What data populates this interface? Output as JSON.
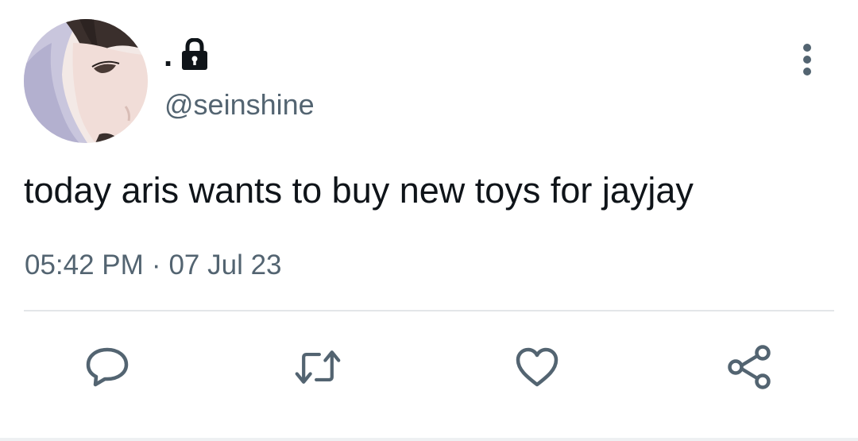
{
  "user": {
    "display_name": ".",
    "handle": "@seinshine",
    "protected_icon": "lock-icon",
    "avatar_icon": "avatar"
  },
  "tweet": {
    "text": "today aris wants to buy new toys for jayjay",
    "time": "05:42 PM",
    "separator": "·",
    "date": "07 Jul 23"
  },
  "actions": [
    {
      "name": "reply",
      "icon": "speech-bubble-icon"
    },
    {
      "name": "retweet",
      "icon": "retweet-icon"
    },
    {
      "name": "like",
      "icon": "heart-icon"
    },
    {
      "name": "share",
      "icon": "share-icon"
    }
  ],
  "menu": {
    "icon": "vertical-dots-icon"
  },
  "colors": {
    "text_primary": "#0f1419",
    "text_secondary": "#536471",
    "divider": "#e3e6e9"
  }
}
